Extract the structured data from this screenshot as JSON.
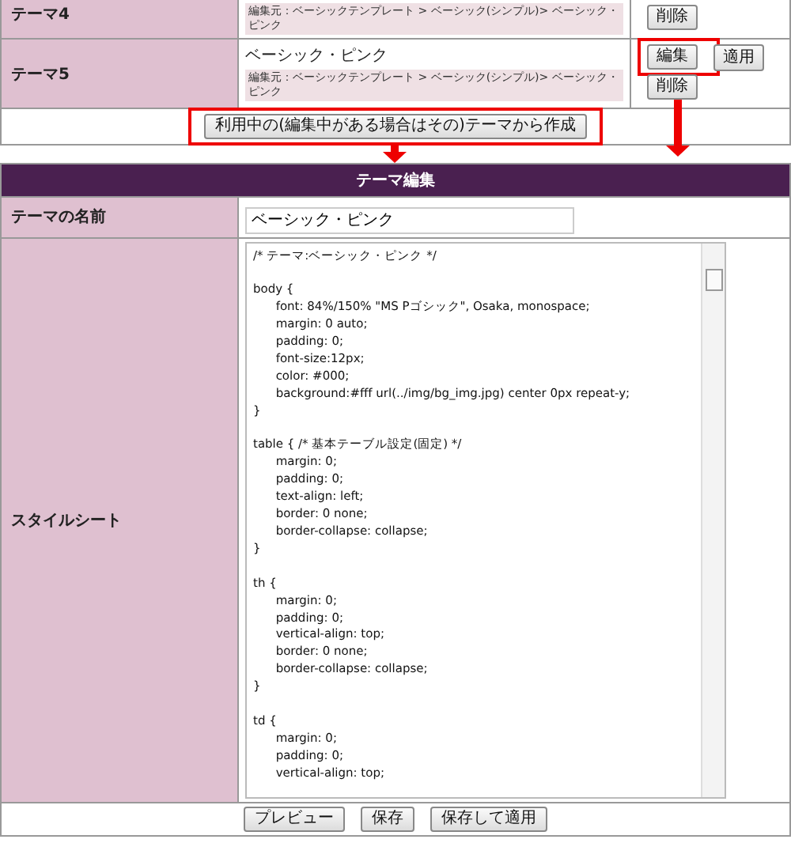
{
  "themes": [
    {
      "label": "テーマ4",
      "source": "編集元：ベーシックテンプレート > ベーシック(シンプル)> ベーシック・ピンク",
      "buttons": [
        "削除"
      ]
    },
    {
      "label": "テーマ5",
      "name": "ベーシック・ピンク",
      "source": "編集元：ベーシックテンプレート > ベーシック(シンプル)> ベーシック・ピンク",
      "buttons": [
        "編集",
        "適用",
        "削除"
      ]
    }
  ],
  "create_button": "利用中の(編集中がある場合はその)テーマから作成",
  "editor": {
    "title": "テーマ編集",
    "name_label": "テーマの名前",
    "name_value": "ベーシック・ピンク",
    "stylesheet_label": "スタイルシート",
    "stylesheet": "/* テーマ:ベーシック・ピンク */\n\nbody {\n\tfont: 84%/150% \"MS Pゴシック\", Osaka, monospace;\n\tmargin: 0 auto;\n\tpadding: 0;\n\tfont-size:12px;\n\tcolor: #000;\n\tbackground:#fff url(../img/bg_img.jpg) center 0px repeat-y;\n}\n\ntable { /* 基本テーブル設定(固定) */\n\tmargin: 0;\n\tpadding: 0;\n\ttext-align: left;\n\tborder: 0 none;\n\tborder-collapse: collapse;\n}\n\nth {\n\tmargin: 0;\n\tpadding: 0;\n\tvertical-align: top;\n\tborder: 0 none;\n\tborder-collapse: collapse;\n}\n\ntd {\n\tmargin: 0;\n\tpadding: 0;\n\tvertical-align: top;"
  },
  "actions": [
    "プレビュー",
    "保存",
    "保存して適用"
  ]
}
